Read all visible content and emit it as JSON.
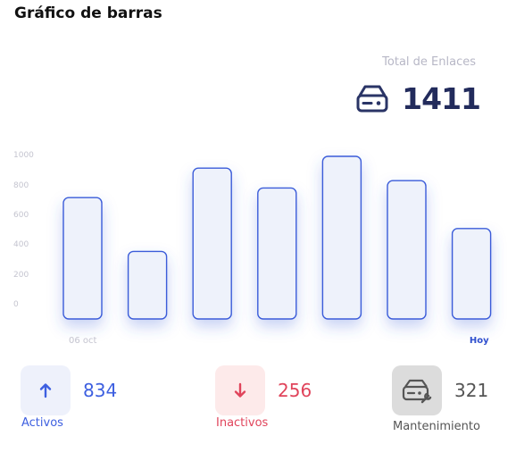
{
  "page": {
    "title": "Gráfico de barras"
  },
  "summary": {
    "total_label": "Total de Enlaces",
    "total_value": "1411",
    "icon": "router-icon"
  },
  "chart_data": {
    "type": "bar",
    "categories": [
      "06 oct",
      "",
      "",
      "",
      "",
      "",
      "Hoy"
    ],
    "values": [
      720,
      355,
      920,
      785,
      1000,
      835,
      510
    ],
    "ylim": [
      0,
      1000
    ],
    "yticks": [
      "1000",
      "800",
      "600",
      "400",
      "200",
      "0"
    ],
    "grid": false,
    "colors": {
      "bar_fill": "#eef2fb",
      "bar_stroke": "#3a5bd9",
      "today": "#2f4fce",
      "tick": "#c4c4cf"
    }
  },
  "stats": {
    "active": {
      "value": "834",
      "label": "Activos",
      "icon": "arrow-up-icon",
      "color": "#3d5fe0",
      "bg": "#eef1fb"
    },
    "inactive": {
      "value": "256",
      "label": "Inactivos",
      "icon": "arrow-down-icon",
      "color": "#e0445b",
      "bg": "#fdeaea"
    },
    "maintenance": {
      "value": "321",
      "label": "Mantenimiento",
      "icon": "router-wrench-icon",
      "color": "#555555",
      "bg": "#dcdcdc"
    }
  }
}
